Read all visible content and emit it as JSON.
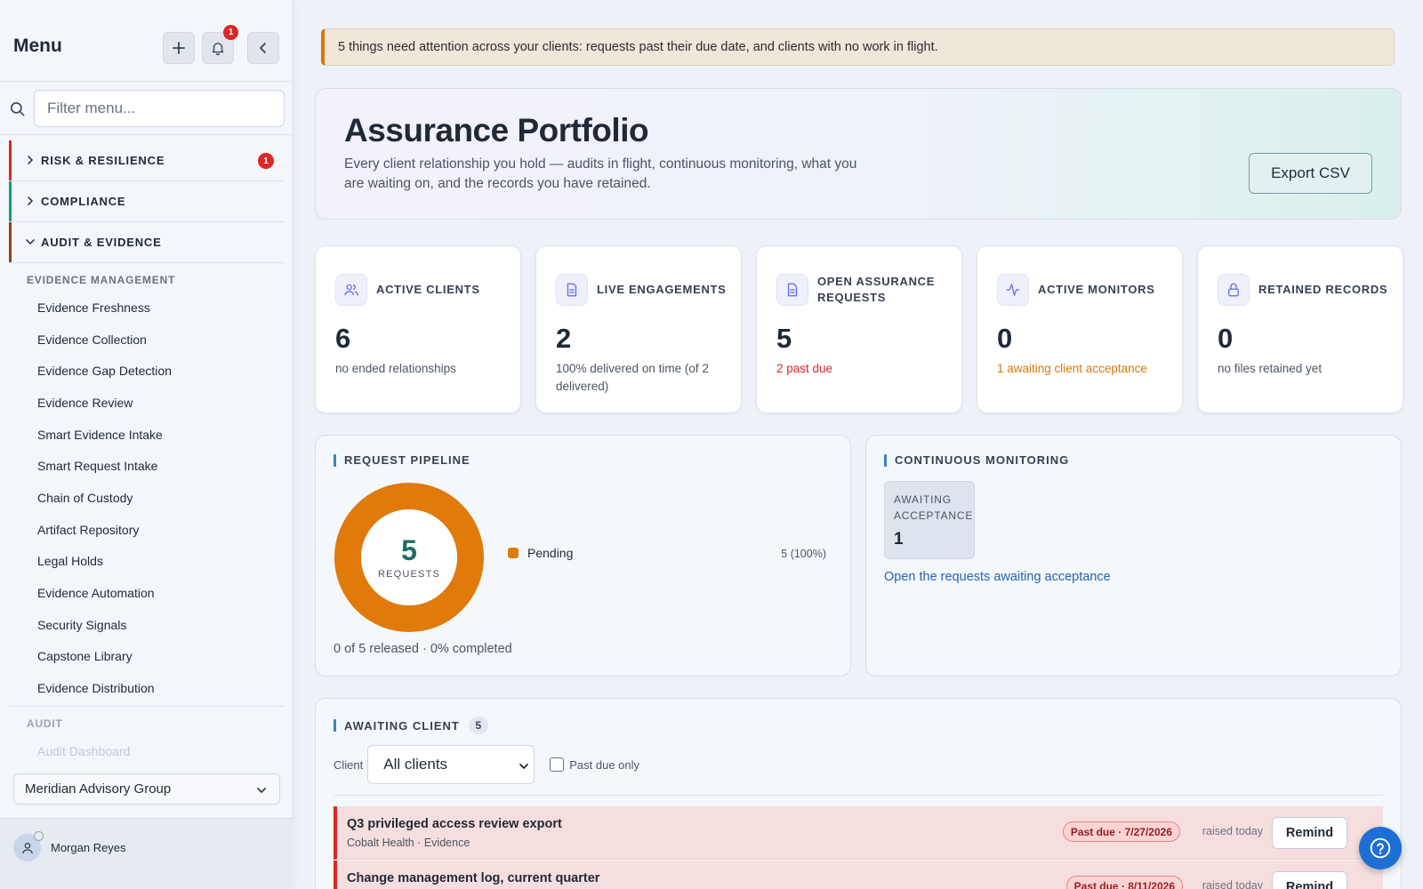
{
  "sidebar": {
    "title": "Menu",
    "notification_count": "1",
    "search_placeholder": "Filter menu...",
    "groups": [
      {
        "label": "RISK & RESILIENCE",
        "badge": "1",
        "color": "#dc2626"
      },
      {
        "label": "COMPLIANCE",
        "color": "#0f9d7a"
      },
      {
        "label": "AUDIT & EVIDENCE",
        "color": "#8b4513"
      }
    ],
    "evidence_heading": "EVIDENCE MANAGEMENT",
    "items": [
      {
        "label": "Evidence Freshness"
      },
      {
        "label": "Evidence Collection"
      },
      {
        "label": "Evidence Gap Detection"
      },
      {
        "label": "Evidence Review"
      },
      {
        "label": "Smart Evidence Intake"
      },
      {
        "label": "Smart Request Intake"
      },
      {
        "label": "Chain of Custody"
      },
      {
        "label": "Artifact Repository"
      },
      {
        "label": "Legal Holds"
      },
      {
        "label": "Evidence Automation"
      },
      {
        "label": "Security Signals"
      },
      {
        "label": "Capstone Library"
      },
      {
        "label": "Evidence Distribution"
      }
    ],
    "audit_heading": "AUDIT",
    "audit_items": [
      {
        "label": "Audit Dashboard"
      }
    ],
    "org_selector": "Meridian Advisory Group",
    "user_name": "Morgan Reyes"
  },
  "alert": {
    "text": "5 things need attention across your clients: requests past their due date, and clients with no work in flight."
  },
  "hero": {
    "title": "Assurance Portfolio",
    "description": "Every client relationship you hold — audits in flight, continuous monitoring, what you are waiting on, and the records you have retained.",
    "export_label": "Export CSV"
  },
  "stats": [
    {
      "label": "ACTIVE CLIENTS",
      "value": "6",
      "sub": "no ended relationships",
      "sub_color": "#4b5563"
    },
    {
      "label": "LIVE ENGAGEMENTS",
      "value": "2",
      "sub": "100% delivered on time (of 2 delivered)",
      "sub_color": "#4b5563"
    },
    {
      "label": "OPEN ASSURANCE REQUESTS",
      "value": "5",
      "sub": "2 past due",
      "sub_color": "#dc2626"
    },
    {
      "label": "ACTIVE MONITORS",
      "value": "0",
      "sub": "1 awaiting client acceptance",
      "sub_color": "#d97706"
    },
    {
      "label": "RETAINED RECORDS",
      "value": "0",
      "sub": "no files retained yet",
      "sub_color": "#4b5563"
    }
  ],
  "pipeline": {
    "title": "REQUEST PIPELINE",
    "total": "5",
    "total_label": "REQUESTS",
    "legend": [
      {
        "label": "Pending",
        "value": "5 (100%)",
        "fraction": 1.0,
        "color": "#e07a0a"
      }
    ],
    "footer": "0 of 5 released · 0% completed"
  },
  "monitoring": {
    "title": "CONTINUOUS MONITORING",
    "tile_label": "AWAITING ACCEPTANCE",
    "tile_value": "1",
    "link": "Open the requests awaiting acceptance"
  },
  "awaiting": {
    "title": "AWAITING CLIENT",
    "count": "5",
    "client_label": "Client",
    "client_value": "All clients",
    "past_due_label": "Past due only",
    "rows": [
      {
        "title": "Q3 privileged access review export",
        "sub": "Cobalt Health · Evidence",
        "due": "Past due · 7/27/2026",
        "raised": "raised today",
        "action": "Remind"
      },
      {
        "title": "Change management log, current quarter",
        "sub": "",
        "due": "Past due · 8/11/2026",
        "raised": "raised today",
        "action": "Remind"
      }
    ]
  }
}
